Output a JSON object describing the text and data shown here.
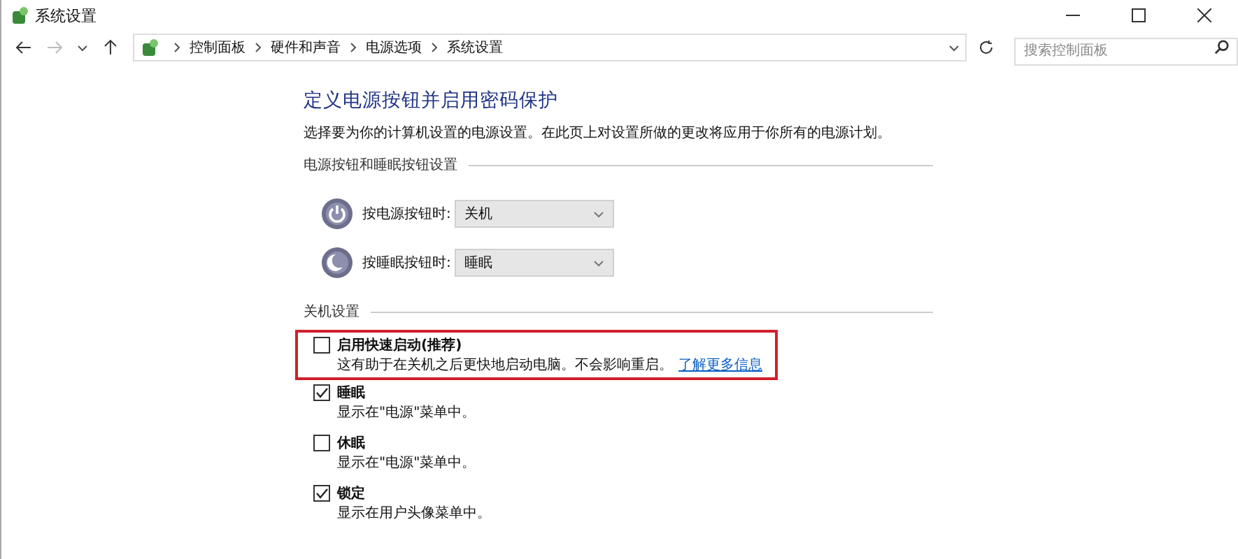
{
  "window": {
    "title": "系统设置"
  },
  "address_bar": {
    "breadcrumbs": [
      "控制面板",
      "硬件和声音",
      "电源选项",
      "系统设置"
    ]
  },
  "search": {
    "placeholder": "搜索控制面板"
  },
  "heading": "定义电源按钮并启用密码保护",
  "description": "选择要为你的计算机设置的电源设置。在此页上对设置所做的更改将应用于你所有的电源计划。",
  "power_section": {
    "title": "电源按钮和睡眠按钮设置",
    "rows": [
      {
        "kind": "power",
        "label": "按电源按钮时:",
        "value": "关机"
      },
      {
        "kind": "sleep",
        "label": "按睡眠按钮时:",
        "value": "睡眠"
      }
    ]
  },
  "shutdown_section": {
    "title": "关机设置",
    "options": [
      {
        "label": "启用快速启动(推荐)",
        "checked": false,
        "highlighted": true,
        "description": "这有助于在关机之后更快地启动电脑。不会影响重启。",
        "link": "了解更多信息"
      },
      {
        "label": "睡眠",
        "checked": true,
        "highlighted": false,
        "description": "显示在\"电源\"菜单中。"
      },
      {
        "label": "休眠",
        "checked": false,
        "highlighted": false,
        "description": "显示在\"电源\"菜单中。"
      },
      {
        "label": "锁定",
        "checked": true,
        "highlighted": false,
        "description": "显示在用户头像菜单中。"
      }
    ]
  }
}
